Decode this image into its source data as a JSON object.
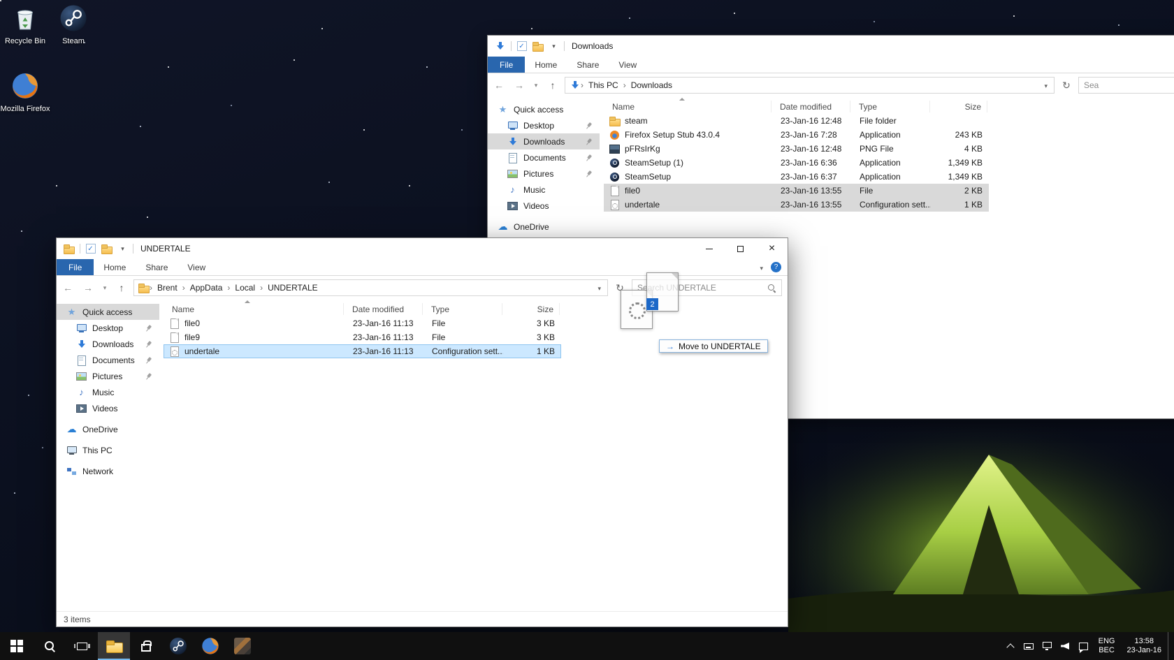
{
  "colors": {
    "accent": "#0078d7",
    "file_tab": "#2966ae",
    "selection_active": "#cce8ff",
    "selection_inactive": "#d9d9d9",
    "taskbar_bg": "#101010",
    "drag_badge": "#1c68c8"
  },
  "icons": {
    "search-icon": "css magnifier (circle + handle)",
    "refresh-icon": "↻",
    "back-icon": "←",
    "forward-icon": "→",
    "up-icon": "↑",
    "chevron-down-icon": "▾",
    "chevron-up-icon": "css chevron",
    "sort-ascending-icon": "css triangle up",
    "close-icon": "×",
    "minimize-icon": "css bar",
    "maximize-icon": "css square",
    "help-icon": "? in blue circle",
    "breadcrumb-separator-icon": "›",
    "quick-access-star-icon": "★",
    "onedrive-cloud-icon": "☁",
    "music-note-icon": "♪",
    "folder-icon": "css yellow folder",
    "file-page-icon": "css white page",
    "config-gear-icon": "css page with dotted gear",
    "firefox-icon": "orange/blue circle",
    "steam-icon": "dark circle with piston",
    "png-image-icon": "css dark thumbnail",
    "desktop-monitor-icon": "css monitor",
    "downloads-arrow-icon": "css blue down arrow",
    "documents-icon": "css lined page",
    "pictures-icon": "css landscape",
    "videos-icon": "css clapper with play",
    "this-pc-icon": "css monitor",
    "network-icon": "css nodes",
    "pin-icon": "css pushpin",
    "start-icon": "css window grid",
    "task-view-icon": "css rects",
    "store-icon": "css shopping bag",
    "recycle-bin-icon": "svg bin",
    "tray-keyboard-icon": "css rect",
    "tray-network-icon": "css monitor",
    "tray-volume-icon": "css speaker",
    "tray-action-center-icon": "css chat bubble",
    "drag-move-arrow-icon": "→"
  },
  "desktop": {
    "icons": [
      {
        "label": "Recycle Bin",
        "icon": "recycle-bin-icon"
      },
      {
        "label": "Steam",
        "icon": "steam-icon"
      },
      {
        "label": "Mozilla Firefox",
        "icon": "firefox-icon"
      }
    ]
  },
  "windows": {
    "downloads": {
      "title": "Downloads",
      "tabs": {
        "file": "File",
        "home": "Home",
        "share": "Share",
        "view": "View"
      },
      "breadcrumbs": [
        "This PC",
        "Downloads"
      ],
      "search_text": "Sea",
      "sidebar": {
        "quick_access": "Quick access",
        "items": [
          {
            "label": "Desktop",
            "icon": "desktop-monitor-icon",
            "pinned": true
          },
          {
            "label": "Downloads",
            "icon": "downloads-arrow-icon",
            "pinned": true,
            "selected": true
          },
          {
            "label": "Documents",
            "icon": "documents-icon",
            "pinned": true
          },
          {
            "label": "Pictures",
            "icon": "pictures-icon",
            "pinned": true
          },
          {
            "label": "Music",
            "icon": "music-note-icon",
            "pinned": false
          },
          {
            "label": "Videos",
            "icon": "videos-icon",
            "pinned": false
          }
        ],
        "onedrive": "OneDrive"
      },
      "columns": {
        "name": "Name",
        "modified": "Date modified",
        "type": "Type",
        "size": "Size"
      },
      "files": [
        {
          "name": "steam",
          "modified": "23-Jan-16 12:48",
          "type": "File folder",
          "size": "",
          "icon": "folder-icon",
          "selected": false
        },
        {
          "name": "Firefox Setup Stub 43.0.4",
          "modified": "23-Jan-16 7:28",
          "type": "Application",
          "size": "243 KB",
          "icon": "firefox-icon",
          "selected": false
        },
        {
          "name": "pFRsIrKg",
          "modified": "23-Jan-16 12:48",
          "type": "PNG File",
          "size": "4 KB",
          "icon": "png-image-icon",
          "selected": false
        },
        {
          "name": "SteamSetup (1)",
          "modified": "23-Jan-16 6:36",
          "type": "Application",
          "size": "1,349 KB",
          "icon": "steam-icon",
          "selected": false
        },
        {
          "name": "SteamSetup",
          "modified": "23-Jan-16 6:37",
          "type": "Application",
          "size": "1,349 KB",
          "icon": "steam-icon",
          "selected": false
        },
        {
          "name": "file0",
          "modified": "23-Jan-16 13:55",
          "type": "File",
          "size": "2 KB",
          "icon": "file-page-icon",
          "selected": true
        },
        {
          "name": "undertale",
          "modified": "23-Jan-16 13:55",
          "type": "Configuration sett...",
          "size": "1 KB",
          "icon": "config-gear-icon",
          "selected": true
        }
      ]
    },
    "undertale": {
      "title": "UNDERTALE",
      "tabs": {
        "file": "File",
        "home": "Home",
        "share": "Share",
        "view": "View"
      },
      "breadcrumbs": [
        "Brent",
        "AppData",
        "Local",
        "UNDERTALE"
      ],
      "search_placeholder": "Search UNDERTALE",
      "sidebar": {
        "quick_access": "Quick access",
        "items": [
          {
            "label": "Desktop",
            "icon": "desktop-monitor-icon",
            "pinned": true
          },
          {
            "label": "Downloads",
            "icon": "downloads-arrow-icon",
            "pinned": true
          },
          {
            "label": "Documents",
            "icon": "documents-icon",
            "pinned": true
          },
          {
            "label": "Pictures",
            "icon": "pictures-icon",
            "pinned": true
          },
          {
            "label": "Music",
            "icon": "music-note-icon",
            "pinned": false
          },
          {
            "label": "Videos",
            "icon": "videos-icon",
            "pinned": false
          }
        ],
        "onedrive": "OneDrive",
        "this_pc": "This PC",
        "network": "Network"
      },
      "columns": {
        "name": "Name",
        "modified": "Date modified",
        "type": "Type",
        "size": "Size"
      },
      "files": [
        {
          "name": "file0",
          "modified": "23-Jan-16 11:13",
          "type": "File",
          "size": "3 KB",
          "icon": "file-page-icon",
          "selected": false
        },
        {
          "name": "file9",
          "modified": "23-Jan-16 11:13",
          "type": "File",
          "size": "3 KB",
          "icon": "file-page-icon",
          "selected": false
        },
        {
          "name": "undertale",
          "modified": "23-Jan-16 11:13",
          "type": "Configuration sett...",
          "size": "1 KB",
          "icon": "config-gear-icon",
          "selected": true
        }
      ],
      "status": "3 items"
    }
  },
  "drag": {
    "badge": "2",
    "tooltip": "Move to UNDERTALE"
  },
  "taskbar": {
    "lang_top": "ENG",
    "lang_bottom": "BEC",
    "time": "13:58",
    "date": "23-Jan-16"
  }
}
